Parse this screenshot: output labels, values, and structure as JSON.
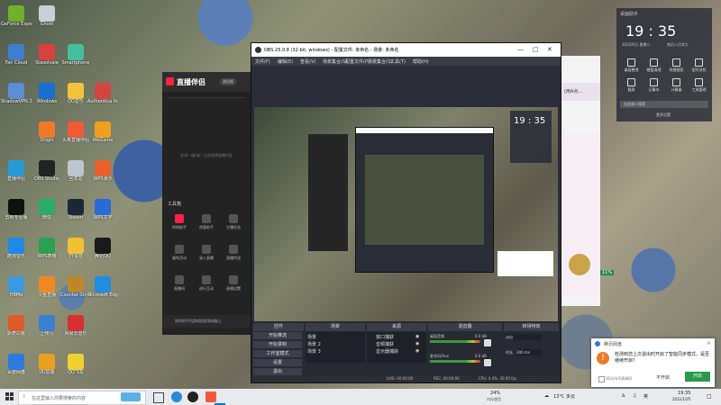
{
  "desktop": {
    "icons": [
      {
        "label": "GeForce Experience",
        "color": "#6fb12a",
        "col": 0,
        "row": 0
      },
      {
        "label": "Ghost",
        "color": "#c8cfd8",
        "col": 1,
        "row": 0
      },
      {
        "label": "Fan Cloud",
        "color": "#3e7ed0",
        "col": 0,
        "row": 1
      },
      {
        "label": "Stasolvale",
        "color": "#d94040",
        "col": 1,
        "row": 1
      },
      {
        "label": "Smartphone",
        "color": "#44c0a0",
        "col": 2,
        "row": 1
      },
      {
        "label": "ShadowVPN 2020",
        "color": "#5a8ed6",
        "col": 0,
        "row": 2
      },
      {
        "label": "Windows",
        "color": "#1a6fd0",
        "col": 1,
        "row": 2
      },
      {
        "label": "QQ音乐",
        "color": "#f2c23a",
        "col": 2,
        "row": 2
      },
      {
        "label": "Authentica tion",
        "color": "#d6443e",
        "col": 3,
        "row": 2
      },
      {
        "label": "Origin",
        "color": "#f07a2a",
        "col": 1,
        "row": 3
      },
      {
        "label": "头条直播伴侣",
        "color": "#f05a38",
        "col": 2,
        "row": 3
      },
      {
        "label": "WeGame",
        "color": "#f0a020",
        "col": 3,
        "row": 3
      },
      {
        "label": "直播伴侣",
        "color": "#2a9ad6",
        "col": 0,
        "row": 4
      },
      {
        "label": "OBS Studio",
        "color": "#222",
        "col": 1,
        "row": 4
      },
      {
        "label": "回收站",
        "color": "#bcc4d0",
        "col": 2,
        "row": 4
      },
      {
        "label": "WPS演示",
        "color": "#e8602c",
        "col": 3,
        "row": 4
      },
      {
        "label": "剪映专业版",
        "color": "#111",
        "col": 0,
        "row": 5
      },
      {
        "label": "微信",
        "color": "#2aae67",
        "col": 1,
        "row": 5
      },
      {
        "label": "Steam",
        "color": "#1b2838",
        "col": 2,
        "row": 5
      },
      {
        "label": "WPS文字",
        "color": "#2a6ad6",
        "col": 3,
        "row": 5
      },
      {
        "label": "酷狗音乐",
        "color": "#1e88e5",
        "col": 0,
        "row": 6
      },
      {
        "label": "WPS表格",
        "color": "#2aa050",
        "col": 1,
        "row": 6
      },
      {
        "label": "YY语音",
        "color": "#f0c030",
        "col": 2,
        "row": 6
      },
      {
        "label": "腾讯QQ",
        "color": "#1a1a1a",
        "col": 3,
        "row": 6
      },
      {
        "label": "HBMe",
        "color": "#3a9ae0",
        "col": 0,
        "row": 7
      },
      {
        "label": "斗鱼直播",
        "color": "#f08a20",
        "col": 1,
        "row": 7
      },
      {
        "label": "Counter-Str Global Off",
        "color": "#c0862a",
        "col": 2,
        "row": 7
      },
      {
        "label": "Microsoft Edge",
        "color": "#1f8de0",
        "col": 3,
        "row": 7
      },
      {
        "label": "斯奇白板",
        "color": "#e05a2a",
        "col": 0,
        "row": 8
      },
      {
        "label": "上传凡",
        "color": "#3a80d0",
        "col": 1,
        "row": 8
      },
      {
        "label": "网易云音乐",
        "color": "#d63030",
        "col": 2,
        "row": 8
      },
      {
        "label": "百度网盘",
        "color": "#2a7ae0",
        "col": 0,
        "row": 9
      },
      {
        "label": "UU加速",
        "color": "#e8a020",
        "col": 1,
        "row": 9
      },
      {
        "label": "QQ飞车",
        "color": "#f0d030",
        "col": 2,
        "row": 9
      }
    ]
  },
  "obs": {
    "title": "OBS 25.0.8 (32-bit, windows) - 配置文件: 未命名 - 场景: 未命名",
    "menu": [
      "文件(F)",
      "编辑(E)",
      "查看(V)",
      "场景集合(S)",
      "配置文件(P)",
      "场景集合(S)",
      "工具(T)",
      "帮助(H)"
    ],
    "panels": {
      "controls_header": "控件",
      "scenes_header": "场景",
      "sources_header": "来源",
      "mixer_header": "混音器",
      "transitions_header": "转场特效",
      "controls_buttons": [
        "开始推流",
        "开始录制",
        "工作室模式",
        "设置",
        "退出"
      ],
      "scenes": [
        "场景",
        "场景 2",
        "场景 3"
      ],
      "sources": [
        "窗口捕获",
        "音频捕获",
        "显示器捕获"
      ],
      "mixer_labels": [
        "桌面音频",
        "麦克风/Aux"
      ],
      "mixer_levels": [
        "0.0 dB",
        "0.0 dB"
      ],
      "transition_value": "淡出",
      "duration_label": "时长",
      "duration_value": "300 ms"
    },
    "status": {
      "live": "LIVE: 00:00:00",
      "rec": "REC: 00:00:00",
      "cpu": "CPU: 4.4%, 30.00 fps"
    }
  },
  "live": {
    "title": "直播伴侣",
    "version": "测试版",
    "placeholder": "在线一键(或 ) 点击选择直播内容",
    "tools_header": "工具箱",
    "tools": [
      "特效助手",
      "房管助手",
      "主播任务",
      "福利活动",
      "录入直播",
      "直播传送",
      "直播间",
      "进行互动",
      "直播设置"
    ],
    "notice": "如何把手机游戏投屏到电脑上"
  },
  "clock": {
    "header": "桌面助手",
    "time": "19 : 35",
    "date": "10月05日 星期二",
    "lunar": "农历八月廿九",
    "shortcuts": [
      "桌面整理",
      "硬盘清理",
      "快捷搜索",
      "定时关机",
      "截屏",
      "记事本",
      "计算器",
      "工具管理"
    ],
    "search_placeholder": "在此键入搜索",
    "more": "更多设置"
  },
  "side": {
    "header": "(用A点...",
    "pct": "11%"
  },
  "popup": {
    "header": "腾讯网盘",
    "body": "检测到您上次退出时开启了智能同步模式，是否继续开启？",
    "checkbox": "30天内不再询问",
    "cancel": "不开启",
    "confirm": "开启"
  },
  "taskbar": {
    "search_placeholder": "在这里输入你要搜索的内容",
    "battery_pct": "24%",
    "battery_label": "内存使用",
    "weather": "13°C 多云",
    "ime": "英",
    "time": "19:35",
    "date": "2021/10/5",
    "accent": "#0078d7"
  }
}
